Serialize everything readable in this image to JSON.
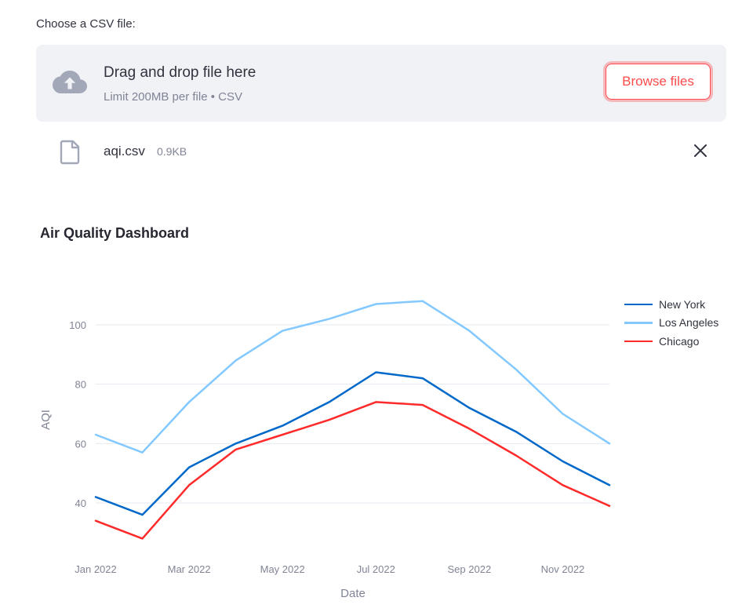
{
  "uploader": {
    "label": "Choose a CSV file:",
    "drop_title": "Drag and drop file here",
    "drop_subtitle": "Limit 200MB per file • CSV",
    "browse_label": "Browse files",
    "upload_icon": "cloud-upload-icon"
  },
  "file": {
    "name": "aqi.csv",
    "size": "0.9KB",
    "icon": "file-icon",
    "remove_icon": "close-icon"
  },
  "chart_data": {
    "type": "line",
    "title": "Air Quality Dashboard",
    "xlabel": "Date",
    "ylabel": "AQI",
    "x": [
      "Jan 2022",
      "Feb 2022",
      "Mar 2022",
      "Apr 2022",
      "May 2022",
      "Jun 2022",
      "Jul 2022",
      "Aug 2022",
      "Sep 2022",
      "Oct 2022",
      "Nov 2022",
      "Dec 2022"
    ],
    "xticks": [
      "Jan 2022",
      "Mar 2022",
      "May 2022",
      "Jul 2022",
      "Sep 2022",
      "Nov 2022"
    ],
    "yticks": [
      40,
      60,
      80,
      100
    ],
    "ylim": [
      25,
      113
    ],
    "grid": true,
    "legend_position": "top-right",
    "series": [
      {
        "name": "New York",
        "color": "#0068c9",
        "values": [
          42,
          36,
          52,
          60,
          66,
          74,
          84,
          82,
          72,
          64,
          54,
          46
        ]
      },
      {
        "name": "Los Angeles",
        "color": "#83c9ff",
        "values": [
          63,
          57,
          74,
          88,
          98,
          102,
          107,
          108,
          98,
          85,
          70,
          60
        ]
      },
      {
        "name": "Chicago",
        "color": "#ff2b2b",
        "values": [
          34,
          28,
          46,
          58,
          63,
          68,
          74,
          73,
          65,
          56,
          46,
          39
        ]
      }
    ]
  }
}
